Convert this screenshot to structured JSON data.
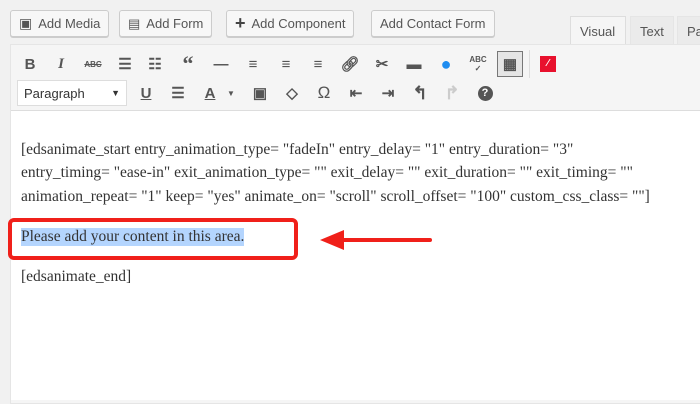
{
  "buttons": {
    "add_media": "Add Media",
    "add_form": "Add Form",
    "add_component": "Add Component",
    "add_contact_form": "Add Contact Form"
  },
  "tabs": {
    "visual": "Visual",
    "text": "Text",
    "partial": "Pa"
  },
  "toolbar": {
    "format_select": "Paragraph",
    "bold": "B",
    "italic": "I",
    "strike": "ABC",
    "underline": "U",
    "text_color": "A",
    "special_char": "Ω",
    "spellcheck": "ABC"
  },
  "content": {
    "lines": [
      "[edsanimate_start entry_animation_type= \"fadeIn\" entry_delay= \"1\" entry_duration= \"3\"",
      "entry_timing= \"ease-in\" exit_animation_type= \"\" exit_delay= \"\" exit_duration= \"\" exit_timing= \"\"",
      "animation_repeat= \"1\" keep= \"yes\" animate_on= \"scroll\" scroll_offset= \"100\" custom_css_class= \"\"]"
    ],
    "selected": "Please add your content in this area.",
    "end": "[edsanimate_end]"
  },
  "colors": {
    "annotation": "#f0201a",
    "selection": "#b4d5fe"
  }
}
